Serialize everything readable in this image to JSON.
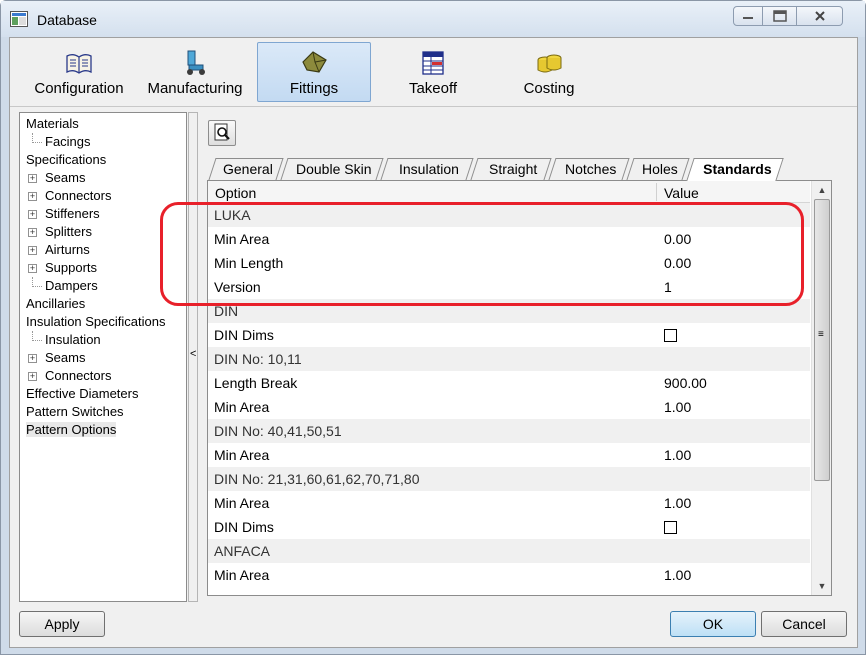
{
  "window": {
    "title": "Database"
  },
  "toolbar": {
    "items": [
      {
        "label": "Configuration",
        "icon": "book-icon"
      },
      {
        "label": "Manufacturing",
        "icon": "machine-icon"
      },
      {
        "label": "Fittings",
        "icon": "fitting-icon",
        "active": true
      },
      {
        "label": "Takeoff",
        "icon": "takeoff-icon"
      },
      {
        "label": "Costing",
        "icon": "coins-icon"
      }
    ]
  },
  "tree": {
    "items": [
      {
        "label": "Materials",
        "level": 0
      },
      {
        "label": "Facings",
        "level": 1,
        "expander": false
      },
      {
        "label": "Specifications",
        "level": 0
      },
      {
        "label": "Seams",
        "level": 1,
        "expander": true
      },
      {
        "label": "Connectors",
        "level": 1,
        "expander": true
      },
      {
        "label": "Stiffeners",
        "level": 1,
        "expander": true
      },
      {
        "label": "Splitters",
        "level": 1,
        "expander": true
      },
      {
        "label": "Airturns",
        "level": 1,
        "expander": true
      },
      {
        "label": "Supports",
        "level": 1,
        "expander": true
      },
      {
        "label": "Dampers",
        "level": 1,
        "expander": false
      },
      {
        "label": "Ancillaries",
        "level": 0
      },
      {
        "label": "Insulation Specifications",
        "level": 0
      },
      {
        "label": "Insulation",
        "level": 1,
        "expander": false
      },
      {
        "label": "Seams",
        "level": 1,
        "expander": true
      },
      {
        "label": "Connectors",
        "level": 1,
        "expander": true
      },
      {
        "label": "Effective Diameters",
        "level": 0
      },
      {
        "label": "Pattern Switches",
        "level": 0
      },
      {
        "label": "Pattern Options",
        "level": 0,
        "selected": true
      }
    ]
  },
  "splitter": {
    "glyph": "<"
  },
  "tabs": [
    {
      "label": "General"
    },
    {
      "label": "Double Skin"
    },
    {
      "label": "Insulation"
    },
    {
      "label": "Straight"
    },
    {
      "label": "Notches"
    },
    {
      "label": "Holes"
    },
    {
      "label": "Standards",
      "active": true
    }
  ],
  "grid": {
    "col_option": "Option",
    "col_value": "Value",
    "rows": [
      {
        "option": "LUKA",
        "value": "",
        "group": true
      },
      {
        "option": "Min Area",
        "value": "0.00"
      },
      {
        "option": "Min Length",
        "value": "0.00"
      },
      {
        "option": "Version",
        "value": "1"
      },
      {
        "option": "DIN",
        "value": "",
        "group": true
      },
      {
        "option": "DIN Dims",
        "value": "",
        "checkbox": true
      },
      {
        "option": "DIN No: 10,11",
        "value": "",
        "group": true
      },
      {
        "option": "Length Break",
        "value": "900.00"
      },
      {
        "option": "Min Area",
        "value": "1.00"
      },
      {
        "option": "DIN No: 40,41,50,51",
        "value": "",
        "group": true
      },
      {
        "option": "Min Area",
        "value": "1.00"
      },
      {
        "option": "DIN No: 21,31,60,61,62,70,71,80",
        "value": "",
        "group": true
      },
      {
        "option": "Min Area",
        "value": "1.00"
      },
      {
        "option": "DIN Dims",
        "value": "",
        "checkbox": true
      },
      {
        "option": "ANFACA",
        "value": "",
        "group": true
      },
      {
        "option": "Min Area",
        "value": "1.00"
      }
    ]
  },
  "buttons": {
    "apply": "Apply",
    "ok": "OK",
    "cancel": "Cancel"
  },
  "colors": {
    "annotation": "#e8202a",
    "active_tab_bg": "#c3daf2"
  }
}
